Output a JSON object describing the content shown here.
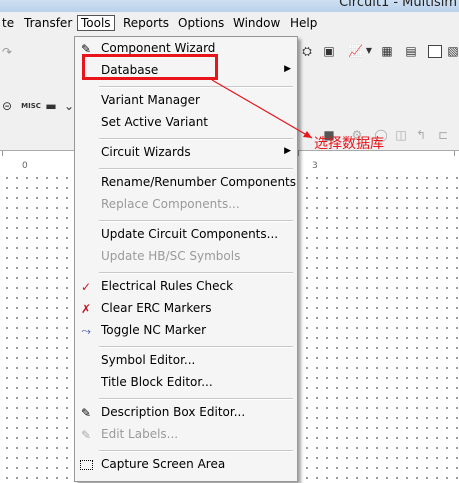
{
  "window": {
    "title": "Circuit1 - Multisim"
  },
  "menubar": {
    "items": [
      {
        "label": "te"
      },
      {
        "label": "Transfer"
      },
      {
        "label": "Tools"
      },
      {
        "label": "Reports"
      },
      {
        "label": "Options"
      },
      {
        "label": "Window"
      },
      {
        "label": "Help"
      }
    ]
  },
  "toolbar2": {
    "misc_label": "MISC"
  },
  "ruler": {
    "ticks": [
      "0",
      "3"
    ]
  },
  "tools_menu": {
    "items": [
      {
        "label": "Component Wizard",
        "icon": "component-wizard-icon",
        "enabled": true
      },
      {
        "label": "Database",
        "submenu": true,
        "enabled": true
      },
      {
        "label": "Variant Manager",
        "enabled": true
      },
      {
        "label": "Set Active Variant",
        "enabled": true
      },
      {
        "label": "Circuit Wizards",
        "submenu": true,
        "enabled": true
      },
      {
        "label": "Rename/Renumber Components",
        "enabled": true
      },
      {
        "label": "Replace Components...",
        "enabled": false
      },
      {
        "label": "Update Circuit Components...",
        "enabled": true
      },
      {
        "label": "Update HB/SC Symbols",
        "enabled": false
      },
      {
        "label": "Electrical Rules Check",
        "icon": "erc-check-icon",
        "enabled": true
      },
      {
        "label": "Clear ERC Markers",
        "icon": "clear-erc-icon",
        "enabled": true
      },
      {
        "label": "Toggle NC Marker",
        "icon": "nc-marker-icon",
        "enabled": true
      },
      {
        "label": "Symbol Editor...",
        "enabled": true
      },
      {
        "label": "Title Block Editor...",
        "enabled": true
      },
      {
        "label": "Description Box Editor...",
        "icon": "description-box-icon",
        "enabled": true
      },
      {
        "label": "Edit Labels...",
        "icon": "edit-labels-icon",
        "enabled": false
      },
      {
        "label": "Capture Screen Area",
        "icon": "capture-screen-icon",
        "enabled": true
      }
    ]
  },
  "annotation": {
    "text": "选择数据库"
  },
  "colors": {
    "highlight": "#e8161b",
    "menu_bg": "#f5f5f5",
    "disabled_text": "#9a9a9a"
  }
}
